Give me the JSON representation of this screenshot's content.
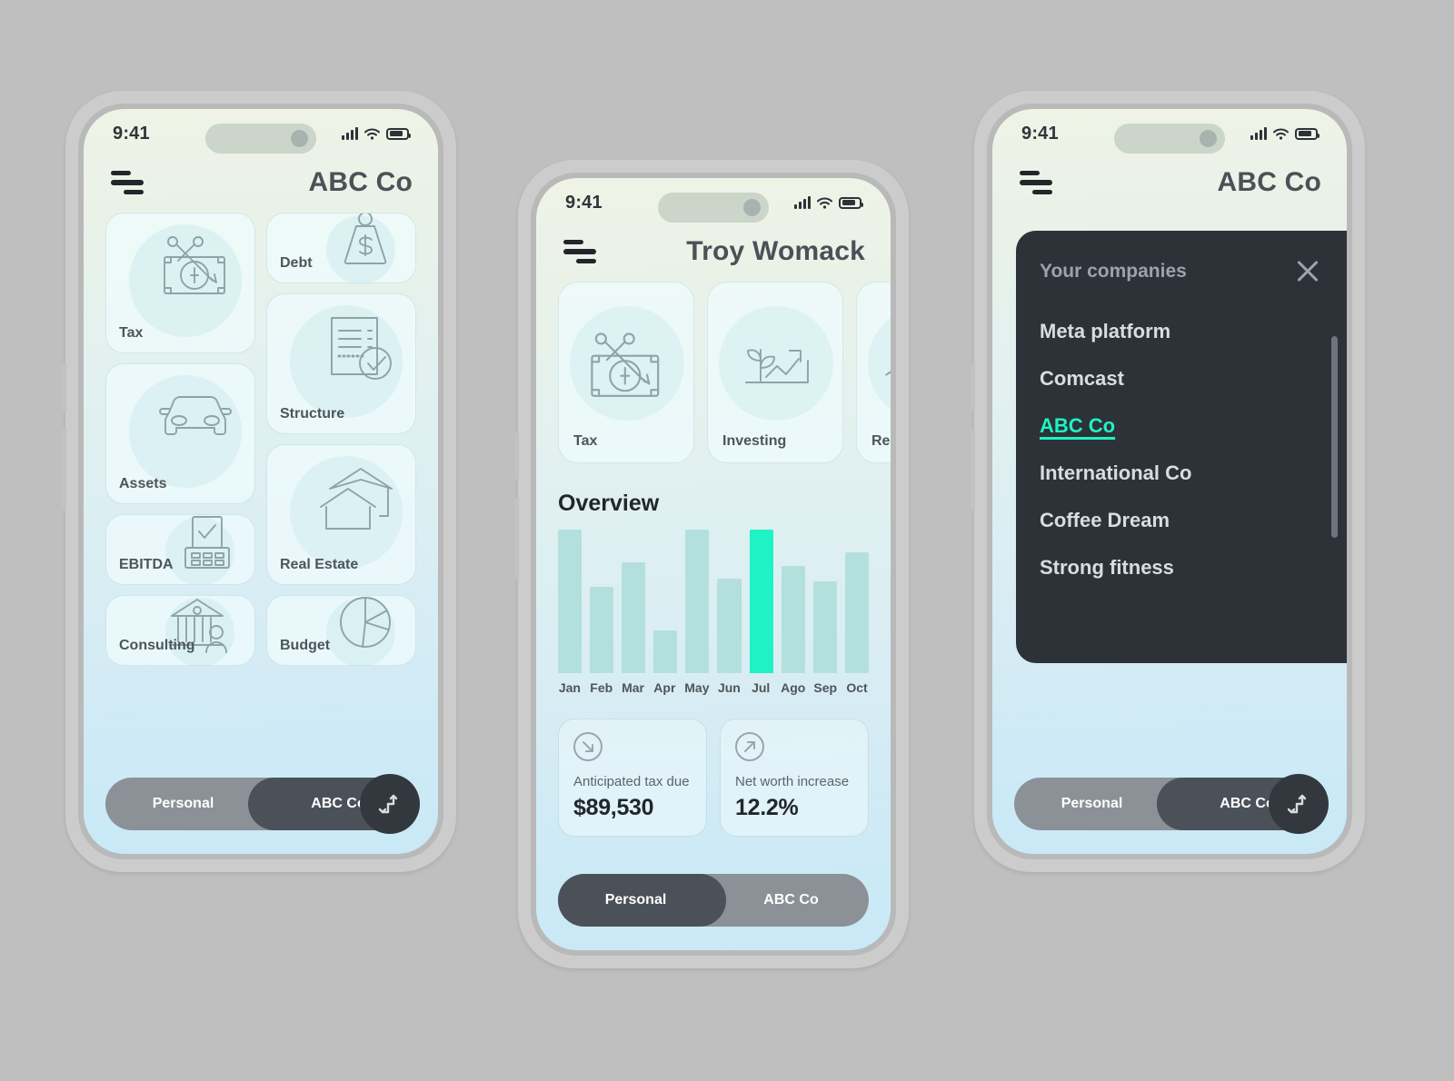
{
  "status_bar": {
    "time": "9:41",
    "signal_icon": "signal-bars-icon",
    "wifi_icon": "wifi-icon",
    "battery_icon": "battery-icon"
  },
  "phone1": {
    "header": {
      "menu_icon": "hamburger-menu-icon",
      "title": "ABC Co"
    },
    "tiles_left": [
      {
        "label": "Tax",
        "icon": "money-scissors-icon",
        "size": "tall"
      },
      {
        "label": "Assets",
        "icon": "car-icon",
        "size": "tall"
      },
      {
        "label": "EBITDA",
        "icon": "calculator-check-icon",
        "size": "short"
      },
      {
        "label": "Consulting",
        "icon": "bank-person-icon",
        "size": "short"
      }
    ],
    "tiles_right": [
      {
        "label": "Debt",
        "icon": "weight-dollar-icon",
        "size": "short"
      },
      {
        "label": "Structure",
        "icon": "document-check-icon",
        "size": "tall"
      },
      {
        "label": "Real Estate",
        "icon": "house-icon",
        "size": "tall"
      },
      {
        "label": "Budget",
        "icon": "pie-chart-icon",
        "size": "short"
      }
    ],
    "toggle": {
      "left_label": "Personal",
      "right_label": "ABC Co",
      "active": "right",
      "swap_icon": "swap-arrows-icon"
    }
  },
  "phone2": {
    "header": {
      "menu_icon": "hamburger-menu-icon",
      "title": "Troy Womack"
    },
    "cards": [
      {
        "label": "Tax",
        "icon": "money-scissors-icon"
      },
      {
        "label": "Investing",
        "icon": "growth-plant-chart-icon"
      },
      {
        "label": "Real Estate",
        "icon": "house-icon"
      }
    ],
    "overview_title": "Overview",
    "stats": [
      {
        "label": "Anticipated tax due",
        "value": "$89,530",
        "icon": "arrow-down-right-circle-icon"
      },
      {
        "label": "Net worth increase",
        "value": "12.2%",
        "icon": "arrow-up-right-circle-icon"
      }
    ],
    "toggle": {
      "left_label": "Personal",
      "right_label": "ABC Co",
      "active": "left"
    }
  },
  "phone3": {
    "header": {
      "menu_icon": "hamburger-menu-icon",
      "title": "ABC Co"
    },
    "drawer": {
      "title": "Your companies",
      "close_icon": "close-x-icon",
      "companies": [
        {
          "name": "Meta platform",
          "selected": false
        },
        {
          "name": "Comcast",
          "selected": false
        },
        {
          "name": "ABC Co",
          "selected": true
        },
        {
          "name": "International Co",
          "selected": false
        },
        {
          "name": "Coffee Dream",
          "selected": false
        },
        {
          "name": "Strong fitness",
          "selected": false
        }
      ]
    },
    "toggle": {
      "left_label": "Personal",
      "right_label": "ABC Co",
      "active": "right",
      "swap_icon": "swap-arrows-icon"
    }
  },
  "colors": {
    "accent": "#1ff2c4",
    "bar": "#b3e0dd",
    "dark_panel": "#2d3238",
    "toggle_active": "#4b5158",
    "toggle_inactive": "#8b9197"
  },
  "chart_data": {
    "type": "bar",
    "title": "Overview",
    "categories": [
      "Jan",
      "Feb",
      "Mar",
      "Apr",
      "May",
      "Jun",
      "Jul",
      "Ago",
      "Sep",
      "Oct"
    ],
    "values": [
      100,
      60,
      77,
      30,
      100,
      66,
      100,
      75,
      64,
      84
    ],
    "highlight_category": "Jul",
    "highlight_color": "#1ff2c4",
    "bar_color": "#b3e0dd",
    "xlabel": "",
    "ylabel": "",
    "ylim": [
      0,
      100
    ],
    "grid": false,
    "legend": false
  }
}
